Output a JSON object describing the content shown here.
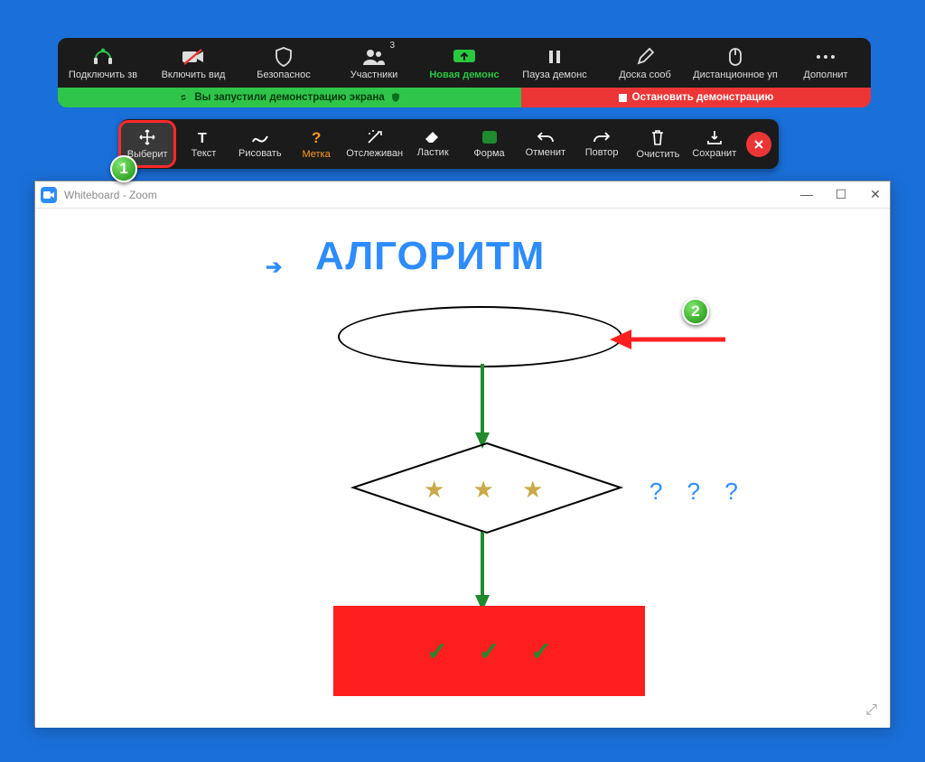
{
  "toolbar": {
    "audio": "Подключить зв",
    "video": "Включить вид",
    "security": "Безопаснос",
    "participants": "Участники",
    "participants_count": "3",
    "new_share": "Новая демонс",
    "pause_share": "Пауза демонс",
    "whiteboard": "Доска сооб",
    "remote": "Дистанционное уп",
    "more": "Дополнит"
  },
  "sharebar": {
    "status": "Вы запустили демонстрацию экрана",
    "stop": "Остановить демонстрацию"
  },
  "annot": {
    "select": "Выберит",
    "text": "Текст",
    "draw": "Рисовать",
    "stamp": "Метка",
    "spotlight": "Отслеживан",
    "eraser": "Ластик",
    "format": "Форма",
    "undo": "Отменит",
    "redo": "Повтор",
    "clear": "Очистить",
    "save": "Сохранит"
  },
  "badges": {
    "one": "1",
    "two": "2"
  },
  "window": {
    "title": "Whiteboard - Zoom"
  },
  "content": {
    "title": "АЛГОРИТМ",
    "stars": "★ ★ ★",
    "qmarks": "? ? ?"
  }
}
